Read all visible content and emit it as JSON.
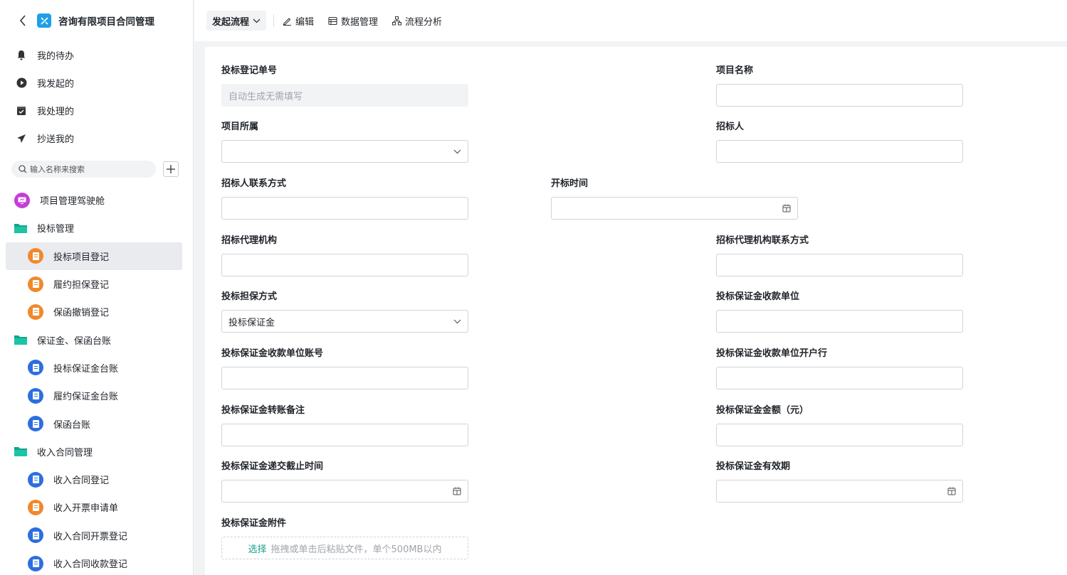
{
  "app": {
    "title": "咨询有限项目合同管理"
  },
  "nav": [
    {
      "label": "我的待办",
      "icon": "bell-icon"
    },
    {
      "label": "我发起的",
      "icon": "play-circle-icon"
    },
    {
      "label": "我处理的",
      "icon": "check-box-icon"
    },
    {
      "label": "抄送我的",
      "icon": "send-icon"
    }
  ],
  "search": {
    "placeholder": "输入名称来搜索"
  },
  "tree": {
    "dashboard": "项目管理驾驶舱",
    "folder1": "投标管理",
    "f1_items": [
      "投标项目登记",
      "履约担保登记",
      "保函撤销登记"
    ],
    "folder2": "保证金、保函台账",
    "f2_items": [
      "投标保证金台账",
      "履约保证金台账",
      "保函台账"
    ],
    "folder3": "收入合同管理",
    "f3_items": [
      "收入合同登记",
      "收入开票申请单",
      "收入合同开票登记",
      "收入合同收款登记"
    ]
  },
  "toolbar": {
    "start": "发起流程",
    "edit": "编辑",
    "data": "数据管理",
    "analysis": "流程分析"
  },
  "form": {
    "bid_no_label": "投标登记单号",
    "bid_no_value": "自动生成无需填写",
    "project_name_label": "项目名称",
    "project_belong_label": "项目所属",
    "tenderer_label": "招标人",
    "tenderer_contact_label": "招标人联系方式",
    "open_time_label": "开标时间",
    "agency_label": "招标代理机构",
    "agency_contact_label": "招标代理机构联系方式",
    "guarantee_type_label": "投标担保方式",
    "guarantee_type_value": "投标保证金",
    "deposit_payee_label": "投标保证金收款单位",
    "deposit_account_label": "投标保证金收款单位账号",
    "deposit_bank_label": "投标保证金收款单位开户行",
    "deposit_remark_label": "投标保证金转账备注",
    "deposit_amount_label": "投标保证金金额（元）",
    "deposit_deadline_label": "投标保证金递交截止时间",
    "deposit_validity_label": "投标保证金有效期",
    "attachment_label": "投标保证金附件",
    "upload_select": "选择",
    "upload_hint": "拖拽或单击后粘贴文件，单个500MB以内"
  }
}
